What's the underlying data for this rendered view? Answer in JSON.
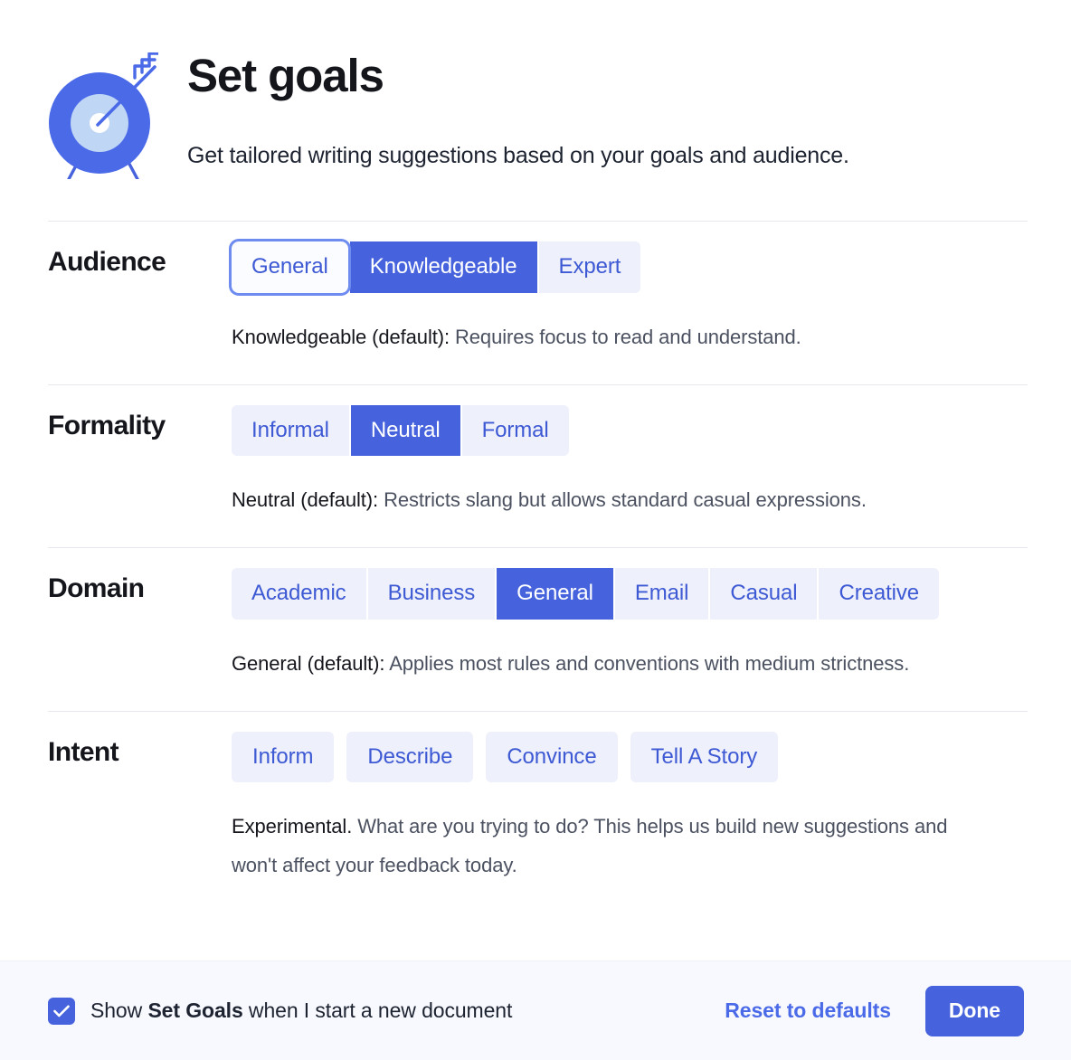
{
  "header": {
    "icon": "target-with-arrow-icon",
    "title": "Set goals",
    "subtitle": "Get tailored writing suggestions based on your goals and audience."
  },
  "colors": {
    "accent": "#4663dd",
    "accent_text": "#3d59d4",
    "segment_bg": "#eef0fb",
    "link": "#4a6ae8",
    "footer_bg": "#f8f9ff",
    "divider": "#e6e8ee",
    "title": "#14161c",
    "helper": "#4b5160"
  },
  "sections": [
    {
      "label": "Audience",
      "type": "segmented",
      "options": [
        {
          "label": "General",
          "state": "focused"
        },
        {
          "label": "Knowledgeable",
          "state": "selected"
        },
        {
          "label": "Expert",
          "state": "normal"
        }
      ],
      "helper_strong": "Knowledgeable (default):",
      "helper_rest": " Requires focus to read and understand."
    },
    {
      "label": "Formality",
      "type": "segmented",
      "options": [
        {
          "label": "Informal",
          "state": "normal"
        },
        {
          "label": "Neutral",
          "state": "selected"
        },
        {
          "label": "Formal",
          "state": "normal"
        }
      ],
      "helper_strong": "Neutral (default):",
      "helper_rest": " Restricts slang but allows standard casual expressions."
    },
    {
      "label": "Domain",
      "type": "segmented",
      "options": [
        {
          "label": "Academic",
          "state": "normal"
        },
        {
          "label": "Business",
          "state": "normal"
        },
        {
          "label": "General",
          "state": "selected"
        },
        {
          "label": "Email",
          "state": "normal"
        },
        {
          "label": "Casual",
          "state": "normal"
        },
        {
          "label": "Creative",
          "state": "normal"
        }
      ],
      "helper_strong": "General (default):",
      "helper_rest": " Applies most rules and conventions with medium strictness."
    },
    {
      "label": "Intent",
      "type": "pills",
      "options": [
        {
          "label": "Inform",
          "state": "normal"
        },
        {
          "label": "Describe",
          "state": "normal"
        },
        {
          "label": "Convince",
          "state": "normal"
        },
        {
          "label": "Tell A Story",
          "state": "normal"
        }
      ],
      "helper_strong": "Experimental.",
      "helper_rest": " What are you trying to do? This helps us build new suggestions and won't affect your feedback today."
    }
  ],
  "footer": {
    "checkbox_checked": true,
    "checkbox_icon": "checkmark-icon",
    "label_before": "Show ",
    "label_strong": "Set Goals",
    "label_after": " when I start a new document",
    "reset_label": "Reset to defaults",
    "done_label": "Done"
  }
}
